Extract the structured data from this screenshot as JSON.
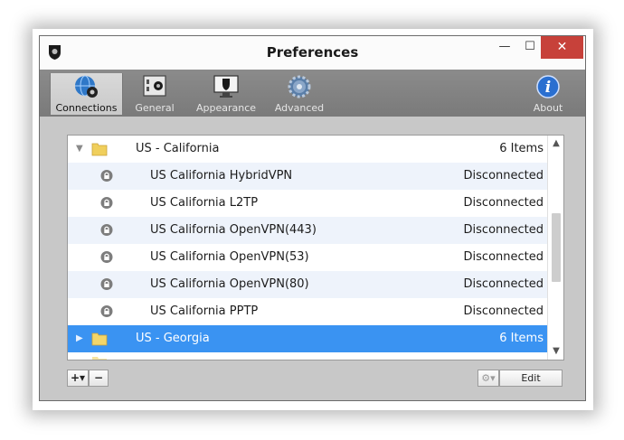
{
  "window": {
    "title": "Preferences",
    "controls": {
      "minimize": "—",
      "maximize": "☐",
      "close": "✕"
    }
  },
  "toolbar": {
    "items": [
      {
        "label": "Connections",
        "icon": "globe-icon",
        "active": true
      },
      {
        "label": "General",
        "icon": "safe-icon",
        "active": false
      },
      {
        "label": "Appearance",
        "icon": "monitor-icon",
        "active": false
      },
      {
        "label": "Advanced",
        "icon": "gear-icon",
        "active": false
      },
      {
        "label": "About",
        "icon": "info-icon",
        "active": false
      }
    ]
  },
  "connections": {
    "groups": [
      {
        "name": "US - California",
        "count": "6 Items",
        "expanded": true,
        "items": [
          {
            "name": "US California HybridVPN",
            "status": "Disconnected"
          },
          {
            "name": "US California L2TP",
            "status": "Disconnected"
          },
          {
            "name": "US California OpenVPN(443)",
            "status": "Disconnected"
          },
          {
            "name": "US California OpenVPN(53)",
            "status": "Disconnected"
          },
          {
            "name": "US California OpenVPN(80)",
            "status": "Disconnected"
          },
          {
            "name": "US California PPTP",
            "status": "Disconnected"
          }
        ]
      },
      {
        "name": "US - Georgia",
        "count": "6 Items",
        "expanded": false,
        "selected": true
      }
    ]
  },
  "bottom_bar": {
    "add_label": "+▾",
    "remove_label": "−",
    "gear_label": "⚙▾",
    "edit_label": "Edit"
  },
  "colors": {
    "selection": "#3a93f2",
    "toolbar": "#808080",
    "close_button": "#c7413a",
    "alt_row": "#eef3fb"
  }
}
